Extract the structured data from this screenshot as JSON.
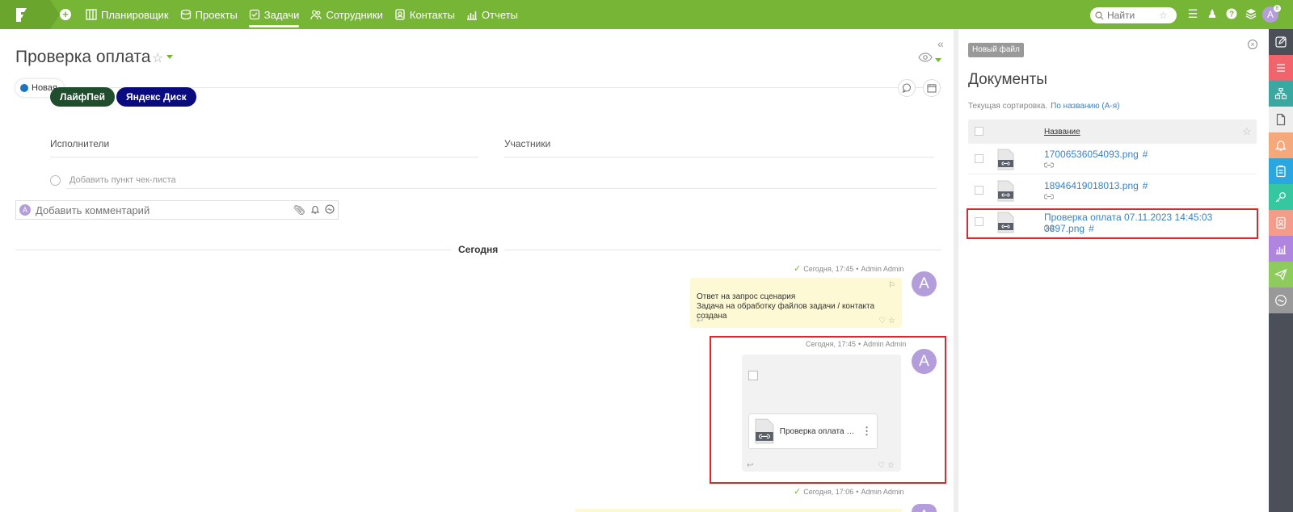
{
  "nav": {
    "items": [
      {
        "label": "Планировщик",
        "icon": "planner-icon"
      },
      {
        "label": "Проекты",
        "icon": "projects-icon"
      },
      {
        "label": "Задачи",
        "icon": "tasks-icon"
      },
      {
        "label": "Сотрудники",
        "icon": "employees-icon"
      },
      {
        "label": "Контакты",
        "icon": "contacts-icon"
      },
      {
        "label": "Отчеты",
        "icon": "reports-icon"
      }
    ],
    "active": "Задачи",
    "search_placeholder": "Найти",
    "avatar_letter": "A",
    "avatar_badge": "8"
  },
  "task": {
    "title": "Проверка оплата",
    "status": "Новая",
    "tags": [
      {
        "label": "ЛайфПей",
        "color": "#1f4d2e"
      },
      {
        "label": "Яндекс Диск",
        "color": "#0b0b80"
      }
    ],
    "executors_label": "Исполнители",
    "participants_label": "Участники",
    "checklist_placeholder": "Добавить пункт чек-листа",
    "comment_placeholder": "Добавить комментарий",
    "comment_avatar": "A"
  },
  "feed": {
    "day_label": "Сегодня",
    "messages": [
      {
        "time": "Сегодня, 17:45",
        "author": "Admin Admin",
        "line1": "Ответ на запрос сценария",
        "line2": "Задача на обработку файлов задачи / контакта создана",
        "avatar": "A"
      },
      {
        "time": "Сегодня, 17:45",
        "author": "Admin Admin",
        "file_name": "Проверка оплата 07.11.2023 14:45:03 3897.png",
        "file_short": "Проверка оплата 0...",
        "avatar": "A"
      },
      {
        "time": "Сегодня, 17:06",
        "author": "Admin Admin",
        "avatar": "A"
      }
    ]
  },
  "documents": {
    "new_file_label": "Новый файл",
    "title": "Документы",
    "sort_label": "Текущая сортировка.",
    "sort_value": "По названию (А-я)",
    "column_name": "Название",
    "files": [
      {
        "name": "17006536054093.png",
        "hash": "#"
      },
      {
        "name": "18946419018013.png",
        "hash": "#"
      },
      {
        "name": "Проверка оплата 07.11.2023 14:45:03 3897.png",
        "hash": "#"
      }
    ]
  },
  "colors": {
    "brand_green": "#76b536",
    "link_blue": "#3b82c4",
    "highlight_red": "#e0262a",
    "rail": [
      "#4a4f58",
      "#f2646b",
      "#3aa8a0",
      "#eeeeee",
      "#f5a97a",
      "#2aa7e0",
      "#34c7a0",
      "#f59b8a",
      "#b085e0",
      "#8dcb5c",
      "#999999"
    ]
  }
}
